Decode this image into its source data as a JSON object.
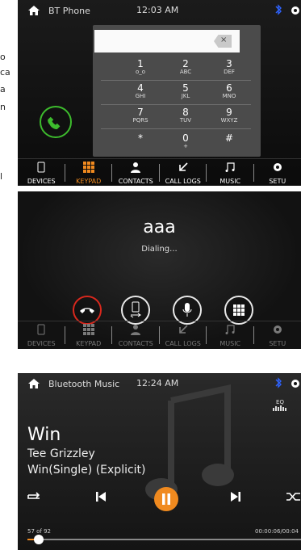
{
  "left_fragments": [
    "o",
    "ca",
    "a",
    "n",
    "l"
  ],
  "screen1": {
    "status": {
      "title": "BT Phone",
      "time": "12:03 AM"
    },
    "keypad": {
      "entry_value": "",
      "keys": [
        {
          "digit": "1",
          "letters": "o_o"
        },
        {
          "digit": "2",
          "letters": "ABC"
        },
        {
          "digit": "3",
          "letters": "DEF"
        },
        {
          "digit": "4",
          "letters": "GHI"
        },
        {
          "digit": "5",
          "letters": "JKL"
        },
        {
          "digit": "6",
          "letters": "MNO"
        },
        {
          "digit": "7",
          "letters": "PQRS"
        },
        {
          "digit": "8",
          "letters": "TUV"
        },
        {
          "digit": "9",
          "letters": "WXYZ"
        },
        {
          "digit": "*",
          "letters": ""
        },
        {
          "digit": "0",
          "letters": "+"
        },
        {
          "digit": "#",
          "letters": ""
        }
      ],
      "backspace_label": "×"
    },
    "nav": [
      {
        "label": "DEVICES",
        "icon": "phone-device-icon"
      },
      {
        "label": "KEYPAD",
        "icon": "keypad-grid-icon",
        "active": true
      },
      {
        "label": "CONTACTS",
        "icon": "person-icon"
      },
      {
        "label": "CALL LOGS",
        "icon": "arrow-in-icon"
      },
      {
        "label": "MUSIC",
        "icon": "music-note-icon"
      },
      {
        "label": "SETU",
        "icon": "gear-icon"
      }
    ]
  },
  "screen2": {
    "callee": "aaa",
    "status": "Dialing...",
    "nav": [
      {
        "label": "DEVICES"
      },
      {
        "label": "KEYPAD"
      },
      {
        "label": "CONTACTS"
      },
      {
        "label": "CALL LOGS"
      },
      {
        "label": "MUSIC"
      },
      {
        "label": "SETU"
      }
    ]
  },
  "screen3": {
    "status": {
      "title": "Bluetooth Music",
      "time": "12:24 AM"
    },
    "eq_label": "EQ",
    "song": "Win",
    "artist": "Tee Grizzley",
    "album": "Win(Single) (Explicit)",
    "track_count": "57 of 92",
    "elapsed": "00:00:06/00:04",
    "progress": 0.04
  },
  "colors": {
    "accent_orange": "#f08a1f",
    "call_green": "#3dbb2d",
    "end_red": "#d9281d",
    "bluetooth_blue": "#2e63ff"
  }
}
